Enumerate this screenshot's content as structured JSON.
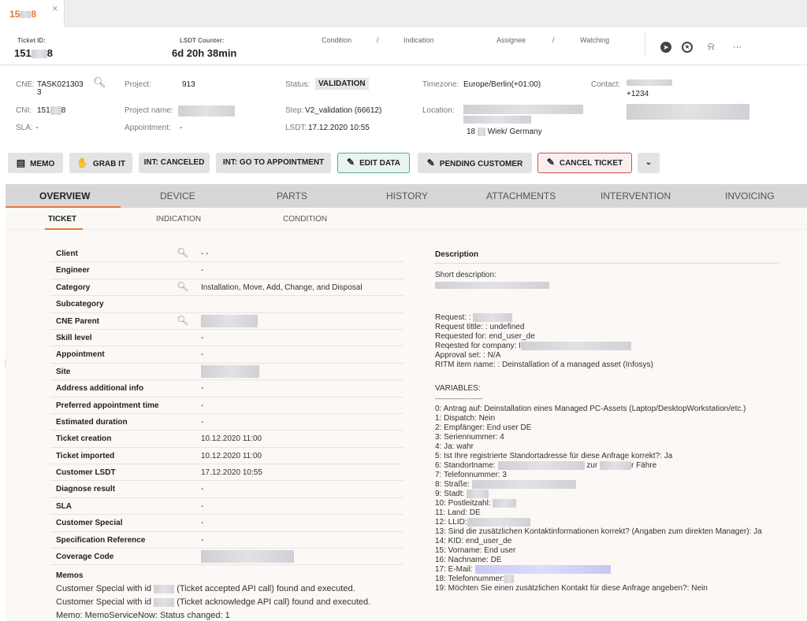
{
  "tab": {
    "label_prefix": "15",
    "label_suffix": "8",
    "close": "×"
  },
  "header": {
    "ticket_id_label": "Ticket ID:",
    "ticket_id_prefix": "151",
    "ticket_id_suffix": "8",
    "lsdt_label": "LSDT Counter:",
    "lsdt_value": "6d 20h 38min",
    "condition": "Condition",
    "sep1": "/",
    "indication": "Indication",
    "assignee": "Assignee",
    "sep2": "/",
    "watching": "Watching",
    "more": "···"
  },
  "info": {
    "cne_label": "CNE:",
    "cne_value": "TASK021303",
    "cne_value_2": "3",
    "cni_label": "CNI:",
    "cni_prefix": "151",
    "cni_suffix": "8",
    "sla_label": "SLA:",
    "sla_value": "-",
    "project_label": "Project:",
    "project_value": "913",
    "project_name_label": "Project name:",
    "appointment_label": "Appointment:",
    "appointment_value": "-",
    "status_label": "Status:",
    "status_value": "VALIDATION",
    "step_label": "Step:",
    "step_value": "V2_validation (66612)",
    "lsdt_label": "LSDT:",
    "lsdt_value": "17.12.2020 10:55",
    "timezone_label": "Timezone:",
    "timezone_value": "Europe/Berlin(+01:00)",
    "location_label": "Location:",
    "location_city_prefix": "18",
    "location_city_suffix": "Wiek/ Germany",
    "contact_label": "Contact:",
    "contact_phone": "+1234"
  },
  "actions": {
    "memo": "MEMO",
    "grab": "GRAB IT",
    "int_canceled": "INT: CANCELED",
    "int_go": "INT: GO TO APPOINTMENT",
    "edit": "EDIT DATA",
    "pending": "PENDING CUSTOMER",
    "cancel": "CANCEL TICKET"
  },
  "nav": {
    "overview": "OVERVIEW",
    "device": "DEVICE",
    "parts": "PARTS",
    "history": "HISTORY",
    "attachments": "ATTACHMENTS",
    "intervention": "INTERVENTION",
    "invoicing": "INVOICING"
  },
  "subnav": {
    "ticket": "TICKET",
    "indication": "INDICATION",
    "condition": "CONDITION"
  },
  "details": [
    {
      "key": "Client",
      "value": "- -"
    },
    {
      "key": "Engineer",
      "value": "-"
    },
    {
      "key": "Category",
      "value": "Installation, Move, Add, Change, and Disposal"
    },
    {
      "key": "Subcategory",
      "value": ""
    },
    {
      "key": "CNE Parent",
      "value": ""
    },
    {
      "key": "Skill level",
      "value": "-"
    },
    {
      "key": "Appointment",
      "value": "-"
    },
    {
      "key": "Site",
      "value": ""
    },
    {
      "key": "Address additional info",
      "value": "-"
    },
    {
      "key": "Preferred appointment time",
      "value": "-"
    },
    {
      "key": "Estimated duration",
      "value": "-"
    },
    {
      "key": "Ticket creation",
      "value": "10.12.2020 11:00"
    },
    {
      "key": "Ticket imported",
      "value": "10.12.2020 11:00"
    },
    {
      "key": "Customer LSDT",
      "value": "17.12.2020 10:55"
    },
    {
      "key": "Diagnose result",
      "value": "-"
    },
    {
      "key": "SLA",
      "value": "-"
    },
    {
      "key": "Customer Special",
      "value": "-"
    },
    {
      "key": "Specification Reference",
      "value": "-"
    },
    {
      "key": "Coverage Code",
      "value": ""
    }
  ],
  "memos": {
    "title": "Memos",
    "line1_a": "Customer Special with id",
    "line1_b": "(Ticket accepted API call) found and executed.",
    "line2_a": "Customer Special with id",
    "line2_b": "(Ticket acknowledge API call) found and executed.",
    "line3": "Memo: MemoServiceNow: Status changed: 1"
  },
  "description": {
    "title": "Description",
    "short_label": "Short description:",
    "request": "Request: :",
    "request_title": "Request tittle: : undefined",
    "requested_for": "Requested for: end_user_de",
    "reqested_company": "Reqested for company: I",
    "approval": "Approval set: : N/A",
    "ritm": "RITM item name: : Deinstallation of a managed asset (Infosys)",
    "variables": "VARIABLES:",
    "dashes": "--------------------------",
    "v0": "0: Antrag auf: Deinstallation eines Managed PC-Assets (Laptop/DesktopWorkstation/etc.)",
    "v1": "1: Dispatch: Nein",
    "v2": "2: Empfänger: End user DE",
    "v3": "3: Seriennummer: 4",
    "v4": "4: Ja: wahr",
    "v5": "5: Ist Ihre registrierte Standortadresse für diese Anfrage korrekt?: Ja",
    "v6_a": "6: Standortname:",
    "v6_b": "zur",
    "v6_c": "r Fähre",
    "v7": "7: Telefonnummer: 3",
    "v8": "8: Straße:",
    "v9": "9: Stadt:",
    "v10": "10: Postleitzahl:",
    "v11": "11: Land: DE",
    "v12": "12: LLID:",
    "v13": "13: Sind die zusätzlichen Kontaktinformationen korrekt? (Angaben zum direkten Manager): Ja",
    "v14": "14: KID: end_user_de",
    "v15": "15: Vorname: End user",
    "v16": "16: Nachname: DE",
    "v17": "17: E-Mail:",
    "v18": "18: Telefonnummer:",
    "v19": "19: Möchten Sie einen zusätzlichen Kontakt für diese Anfrage angeben?: Nein"
  }
}
